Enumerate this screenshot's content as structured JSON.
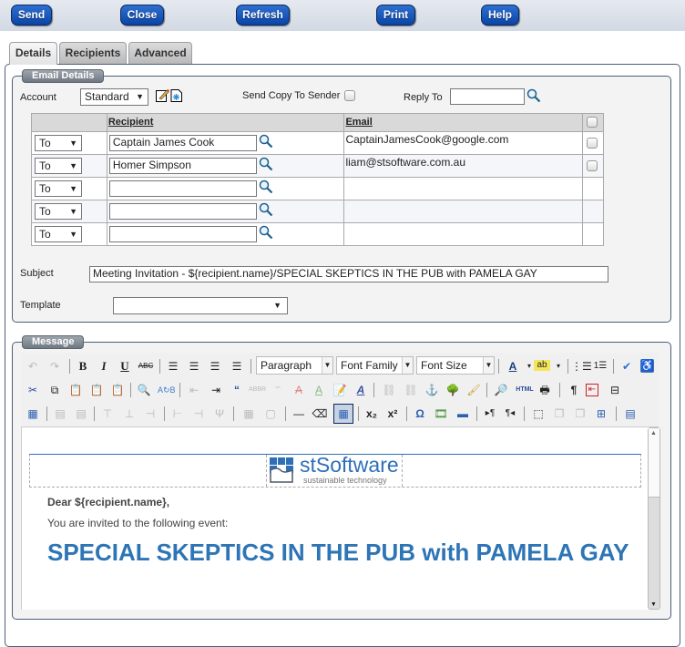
{
  "toolbar": {
    "send": "Send",
    "close": "Close",
    "refresh": "Refresh",
    "print": "Print",
    "help": "Help"
  },
  "tabs": [
    {
      "label": "Details",
      "active": true
    },
    {
      "label": "Recipients",
      "active": false
    },
    {
      "label": "Advanced",
      "active": false
    }
  ],
  "email_details": {
    "legend": "Email Details",
    "account_label": "Account",
    "account_value": "Standard",
    "send_copy_label": "Send Copy To Sender",
    "send_copy_checked": false,
    "reply_to_label": "Reply To",
    "reply_to_value": "",
    "table": {
      "headers": [
        "",
        "Recipient",
        "Email",
        ""
      ],
      "rows": [
        {
          "type": "To",
          "recipient": "Captain James Cook",
          "email": "CaptainJamesCook@google.com",
          "has_checkbox": true
        },
        {
          "type": "To",
          "recipient": "Homer Simpson",
          "email": "liam@stsoftware.com.au",
          "has_checkbox": true
        },
        {
          "type": "To",
          "recipient": "",
          "email": "",
          "has_checkbox": false
        },
        {
          "type": "To",
          "recipient": "",
          "email": "",
          "has_checkbox": false
        },
        {
          "type": "To",
          "recipient": "",
          "email": "",
          "has_checkbox": false
        }
      ]
    },
    "subject_label": "Subject",
    "subject_value": "Meeting Invitation - ${recipient.name}/SPECIAL SKEPTICS IN THE PUB with PAMELA GAY",
    "template_label": "Template",
    "template_value": ""
  },
  "message": {
    "legend": "Message",
    "format_dropdown": "Paragraph",
    "font_family_dropdown": "Font Family",
    "font_size_dropdown": "Font Size",
    "logo_name": "stSoftware",
    "logo_tagline": "sustainable technology",
    "greeting": "Dear ${recipient.name},",
    "intro": "You are invited to the following event:",
    "event_title": "SPECIAL SKEPTICS IN THE PUB with PAMELA GAY"
  },
  "colors": {
    "button_blue": "#0a44a8",
    "event_title": "#2e75b6",
    "logo_blue": "#2e6fb8"
  }
}
